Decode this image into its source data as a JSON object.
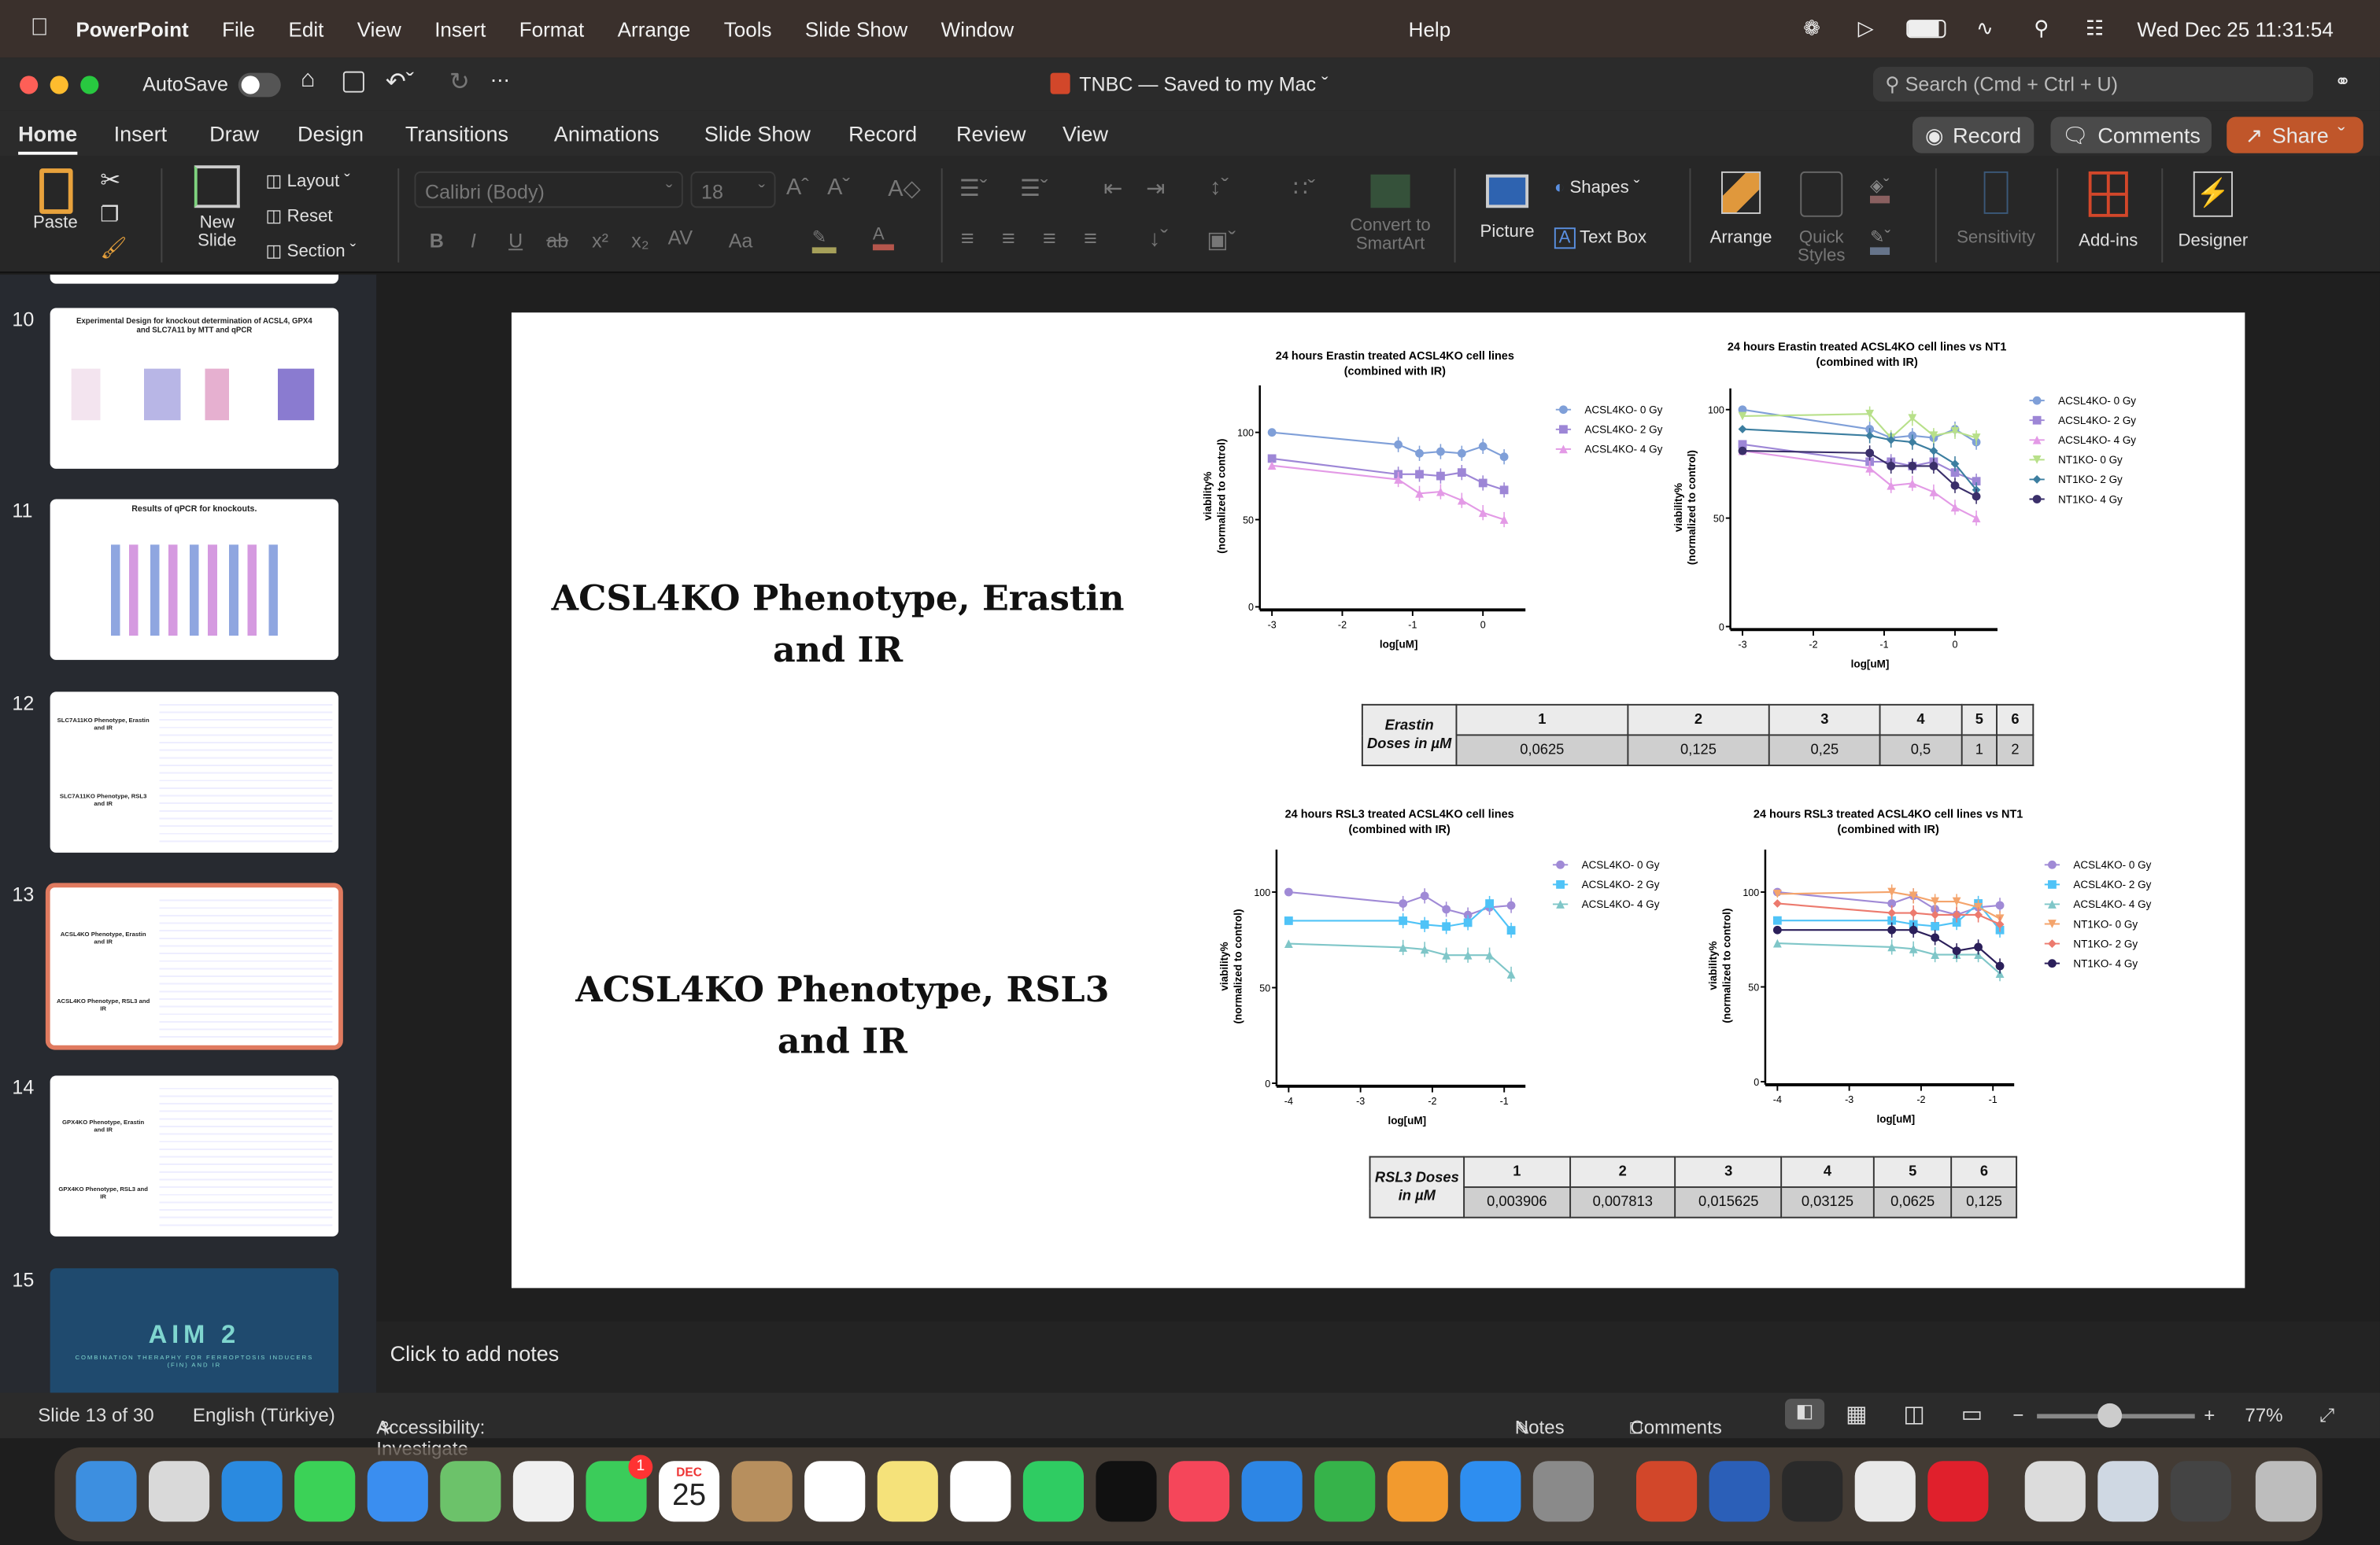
{
  "menubar": {
    "app": "PowerPoint",
    "items": [
      "File",
      "Edit",
      "View",
      "Insert",
      "Format",
      "Arrange",
      "Tools",
      "Slide Show",
      "Window",
      "Help"
    ],
    "clock": "Wed Dec 25  11:31:54"
  },
  "titlebar": {
    "autosave": "AutoSave",
    "doc_title": "TNBC — Saved to my Mac",
    "search_placeholder": "Search (Cmd + Ctrl + U)"
  },
  "tabs": [
    "Home",
    "Insert",
    "Draw",
    "Design",
    "Transitions",
    "Animations",
    "Slide Show",
    "Record",
    "Review",
    "View"
  ],
  "active_tab": "Home",
  "buttons": {
    "record": "Record",
    "comments": "Comments",
    "share": "Share"
  },
  "ribbon": {
    "paste": "Paste",
    "new_slide_1": "New",
    "new_slide_2": "Slide",
    "layout": "Layout",
    "reset": "Reset",
    "section": "Section",
    "font": "Calibri (Body)",
    "font_size": "18",
    "convert_1": "Convert to",
    "convert_2": "SmartArt",
    "picture": "Picture",
    "shapes": "Shapes",
    "text_box": "Text Box",
    "arrange": "Arrange",
    "quick_1": "Quick",
    "quick_2": "Styles",
    "sensitivity": "Sensitivity",
    "addins": "Add-ins",
    "designer": "Designer",
    "fmt": [
      "B",
      "I",
      "U",
      "ab",
      "x²",
      "x₂",
      "AV",
      "Aa"
    ]
  },
  "thumbnails": [
    {
      "num": "10",
      "title": "Experimental Design for knockout determination of ACSL4, GPX4 and SLC7A11 by MTT and qPCR"
    },
    {
      "num": "11",
      "title": "Results of qPCR for knockouts."
    },
    {
      "num": "12",
      "title": "SLC7A11KO Phenotype, Erastin and IR",
      "title2": "SLC7A11KO Phenotype, RSL3 and IR"
    },
    {
      "num": "13",
      "title": "ACSL4KO Phenotype, Erastin and IR",
      "title2": "ACSL4KO Phenotype, RSL3 and IR",
      "selected": true
    },
    {
      "num": "14",
      "title": "GPX4KO Phenotype, Erastin and IR",
      "title2": "GPX4KO Phenotype, RSL3 and IR"
    },
    {
      "num": "15",
      "title": "AIM 2",
      "title2": "COMBINATION THERAPHY FOR FERROPTOSIS INDUCERS (FIN) AND IR"
    }
  ],
  "slide": {
    "heading1": "ACSL4KO Phenotype, Erastin and IR",
    "heading2": "ACSL4KO Phenotype, RSL3 and IR",
    "erastin_table": {
      "label": "Erastin Doses in µM",
      "headers": [
        "1",
        "2",
        "3",
        "4",
        "5",
        "6"
      ],
      "values": [
        "0,0625",
        "0,125",
        "0,25",
        "0,5",
        "1",
        "2"
      ]
    },
    "rsl3_table": {
      "label": "RSL3 Doses in µM",
      "headers": [
        "1",
        "2",
        "3",
        "4",
        "5",
        "6"
      ],
      "values": [
        "0,003906",
        "0,007813",
        "0,015625",
        "0,03125",
        "0,0625",
        "0,125"
      ]
    }
  },
  "chart_data": [
    {
      "type": "line",
      "title": "24 hours Erastin treated ACSL4KO cell lines",
      "subtitle": "(combined with IR)",
      "xlabel": "log[uM]",
      "ylabel": "viability%",
      "ylabel2": "(normalized to control)",
      "xticks": [
        "-3",
        "-2",
        "-1",
        "0"
      ],
      "yticks": [
        "0",
        "50",
        "100"
      ],
      "xlim": [
        -3,
        0.5
      ],
      "ylim": [
        0,
        120
      ],
      "x": [
        -3,
        -1.204,
        -0.903,
        -0.602,
        -0.301,
        0,
        0.301
      ],
      "series": [
        {
          "name": "ACSL4KO- 0 Gy",
          "color": "#7f9fd8",
          "marker": "circle",
          "values": [
            100,
            93,
            88,
            89,
            88,
            92,
            86
          ]
        },
        {
          "name": "ACSL4KO- 2 Gy",
          "color": "#9d86d6",
          "marker": "square",
          "values": [
            85,
            76,
            76,
            75,
            77,
            71,
            67
          ]
        },
        {
          "name": "ACSL4KO- 4 Gy",
          "color": "#e39ae6",
          "marker": "triangle",
          "values": [
            81,
            73,
            65,
            66,
            61,
            54,
            50
          ]
        }
      ]
    },
    {
      "type": "line",
      "title": "24 hours Erastin treated ACSL4KO cell lines vs NT1",
      "subtitle": "(combined with IR)",
      "xlabel": "log[uM]",
      "ylabel": "viability%",
      "ylabel2": "(normalized to control)",
      "xticks": [
        "-3",
        "-2",
        "-1",
        "0"
      ],
      "yticks": [
        "0",
        "50",
        "100"
      ],
      "xlim": [
        -3,
        0.5
      ],
      "ylim": [
        0,
        110
      ],
      "x": [
        -3,
        -1.204,
        -0.903,
        -0.602,
        -0.301,
        0,
        0.301
      ],
      "series": [
        {
          "name": "ACSL4KO- 0 Gy",
          "color": "#7f9fd8",
          "marker": "circle",
          "values": [
            100,
            91,
            87,
            88,
            87,
            91,
            85
          ]
        },
        {
          "name": "ACSL4KO- 2 Gy",
          "color": "#9d86d6",
          "marker": "square",
          "values": [
            84,
            76,
            76,
            74,
            76,
            71,
            67
          ]
        },
        {
          "name": "ACSL4KO- 4 Gy",
          "color": "#e39ae6",
          "marker": "triangle",
          "values": [
            81,
            73,
            65,
            66,
            62,
            55,
            50
          ]
        },
        {
          "name": "NT1KO- 0 Gy",
          "color": "#b8e08a",
          "marker": "triangle-down",
          "values": [
            97,
            98,
            87,
            96,
            88,
            90,
            87
          ]
        },
        {
          "name": "NT1KO- 2 Gy",
          "color": "#3c7ea0",
          "marker": "diamond",
          "values": [
            91,
            88,
            86,
            85,
            81,
            75,
            63
          ]
        },
        {
          "name": "NT1KO- 4 Gy",
          "color": "#3a2f6a",
          "marker": "circle",
          "values": [
            81,
            80,
            74,
            74,
            74,
            65,
            60
          ]
        }
      ]
    },
    {
      "type": "line",
      "title": "24 hours RSL3 treated ACSL4KO cell lines",
      "subtitle": "(combined with IR)",
      "xlabel": "log[uM]",
      "ylabel": "viability%",
      "ylabel2": "(normalized to control)",
      "xticks": [
        "-4",
        "-3",
        "-2",
        "-1"
      ],
      "yticks": [
        "0",
        "50",
        "100"
      ],
      "xlim": [
        -4,
        -0.7
      ],
      "ylim": [
        0,
        120
      ],
      "x": [
        -4,
        -2.408,
        -2.107,
        -1.806,
        -1.505,
        -1.204,
        -0.903
      ],
      "series": [
        {
          "name": "ACSL4KO- 0 Gy",
          "color": "#a08ad6",
          "marker": "circle",
          "values": [
            100,
            94,
            98,
            91,
            88,
            92,
            93
          ]
        },
        {
          "name": "ACSL4KO- 2 Gy",
          "color": "#4fc3f7",
          "marker": "square",
          "values": [
            85,
            85,
            83,
            82,
            84,
            94,
            80
          ]
        },
        {
          "name": "ACSL4KO- 4 Gy",
          "color": "#7fc6c8",
          "marker": "triangle",
          "values": [
            73,
            71,
            70,
            67,
            67,
            67,
            57
          ]
        }
      ]
    },
    {
      "type": "line",
      "title": "24 hours RSL3 treated ACSL4KO cell lines vs NT1",
      "subtitle": "(combined with IR)",
      "xlabel": "log[uM]",
      "ylabel": "viability%",
      "ylabel2": "(normalized to control)",
      "xticks": [
        "-4",
        "-3",
        "-2",
        "-1"
      ],
      "yticks": [
        "0",
        "50",
        "100"
      ],
      "xlim": [
        -4,
        -0.7
      ],
      "ylim": [
        0,
        120
      ],
      "x": [
        -4,
        -2.408,
        -2.107,
        -1.806,
        -1.505,
        -1.204,
        -0.903
      ],
      "series": [
        {
          "name": "ACSL4KO- 0 Gy",
          "color": "#a08ad6",
          "marker": "circle",
          "values": [
            100,
            94,
            98,
            91,
            88,
            92,
            93
          ]
        },
        {
          "name": "ACSL4KO- 2 Gy",
          "color": "#4fc3f7",
          "marker": "square",
          "values": [
            85,
            85,
            83,
            82,
            84,
            94,
            80
          ]
        },
        {
          "name": "ACSL4KO- 4 Gy",
          "color": "#7fc6c8",
          "marker": "triangle",
          "values": [
            73,
            71,
            70,
            67,
            67,
            67,
            57
          ]
        },
        {
          "name": "NT1KO- 0 Gy",
          "color": "#f4a46c",
          "marker": "triangle-down",
          "values": [
            99,
            100,
            98,
            95,
            95,
            92,
            86
          ]
        },
        {
          "name": "NT1KO- 2 Gy",
          "color": "#ec7a6e",
          "marker": "diamond",
          "values": [
            94,
            89,
            89,
            88,
            88,
            88,
            83
          ]
        },
        {
          "name": "NT1KO- 4 Gy",
          "color": "#2b1f5a",
          "marker": "circle",
          "values": [
            80,
            80,
            80,
            76,
            69,
            71,
            61
          ]
        }
      ]
    }
  ],
  "notes": {
    "placeholder": "Click to add notes"
  },
  "status": {
    "slide": "Slide 13 of 30",
    "language": "English (Türkiye)",
    "accessibility": "Accessibility: Investigate",
    "notes": "Notes",
    "comments": "Comments",
    "zoom": "77%",
    "zoom_level": 0.77
  },
  "dock": {
    "calendar_month": "DEC",
    "calendar_day": "25",
    "facetime_badge": "1",
    "apps": [
      {
        "name": "finder",
        "color": "#3d8fe0"
      },
      {
        "name": "launchpad",
        "color": "#d9d9d9"
      },
      {
        "name": "safari",
        "color": "#2a8ae0"
      },
      {
        "name": "messages",
        "color": "#3bd257"
      },
      {
        "name": "mail",
        "color": "#3a8ef0"
      },
      {
        "name": "maps",
        "color": "#6cc26a"
      },
      {
        "name": "photos",
        "color": "#f0f0f0"
      },
      {
        "name": "facetime",
        "color": "#3bcc5a"
      },
      {
        "name": "calendar",
        "color": "#ffffff"
      },
      {
        "name": "contacts",
        "color": "#b78f5e"
      },
      {
        "name": "reminders",
        "color": "#ffffff"
      },
      {
        "name": "notes",
        "color": "#f5e27a"
      },
      {
        "name": "freeform",
        "color": "#ffffff"
      },
      {
        "name": "whatsapp",
        "color": "#2fcc62"
      },
      {
        "name": "apple-tv",
        "color": "#111111"
      },
      {
        "name": "music",
        "color": "#f5465a"
      },
      {
        "name": "keynote",
        "color": "#2d86e5"
      },
      {
        "name": "numbers",
        "color": "#36b34a"
      },
      {
        "name": "pages",
        "color": "#f29a2e"
      },
      {
        "name": "app-store",
        "color": "#2e8ef0"
      },
      {
        "name": "system-settings",
        "color": "#8a8a8a"
      },
      {
        "name": "powerpoint",
        "color": "#d2472a"
      },
      {
        "name": "word",
        "color": "#2b5fb8"
      },
      {
        "name": "chatgpt",
        "color": "#2a2a2a"
      },
      {
        "name": "chrome",
        "color": "#e9e9e9"
      },
      {
        "name": "opera",
        "color": "#e0202c"
      },
      {
        "name": "recent-window-1",
        "color": "#dcdcdc"
      },
      {
        "name": "recent-window-2",
        "color": "#cfd8e3"
      },
      {
        "name": "recent-window-3",
        "color": "#444444"
      },
      {
        "name": "trash",
        "color": "#bdbdbd"
      }
    ]
  }
}
